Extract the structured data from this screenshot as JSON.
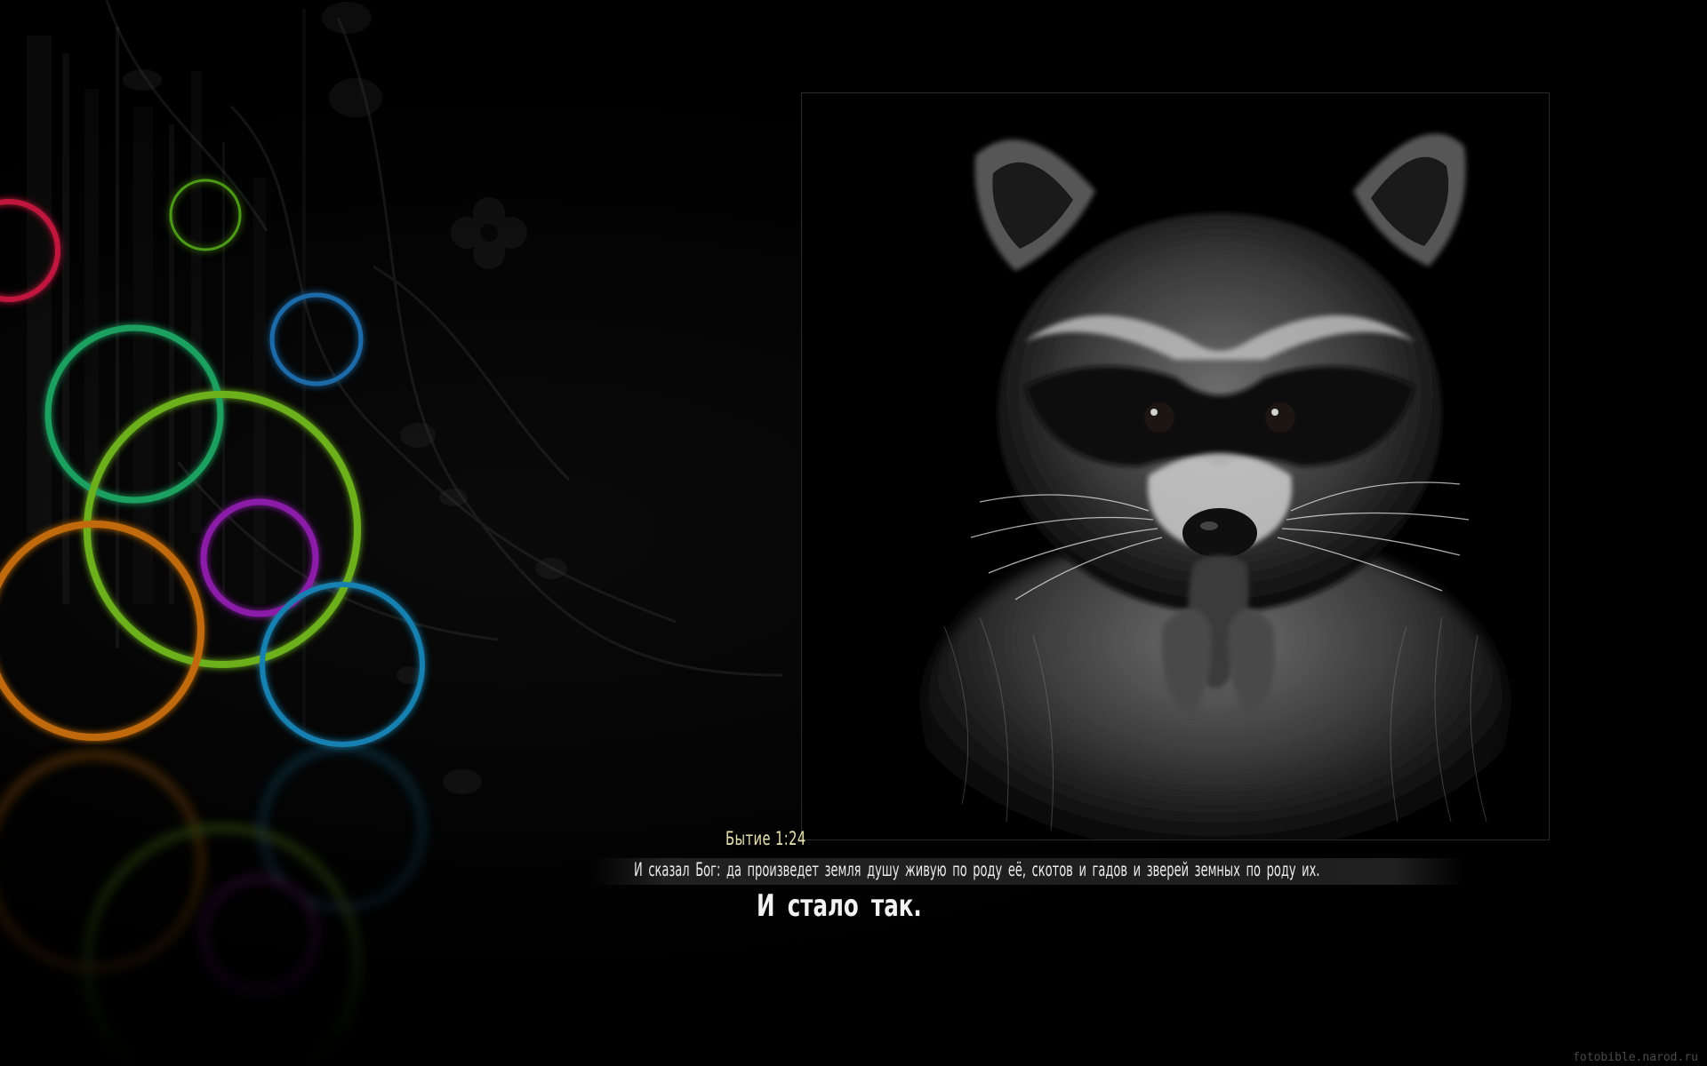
{
  "caption": {
    "reference": "Бытие 1:24",
    "verse": "И сказал Бог: да произведет земля душу живую по роду её, скотов и гадов и зверей земных по роду их.",
    "closing": "И стало так."
  },
  "watermark": "fotobible.narod.ru",
  "colors": {
    "background": "#000000",
    "reference_text": "#e9e2b0",
    "verse_text": "#ececec",
    "frame_border": "#2a2a2a",
    "ring_red": "#c0183c",
    "ring_green": "#1aa060",
    "ring_lime": "#6cb01c",
    "ring_orange": "#c06a10",
    "ring_purple": "#8a1aa8",
    "ring_blue": "#1680b0"
  },
  "photo": {
    "subject": "raccoon-portrait"
  }
}
